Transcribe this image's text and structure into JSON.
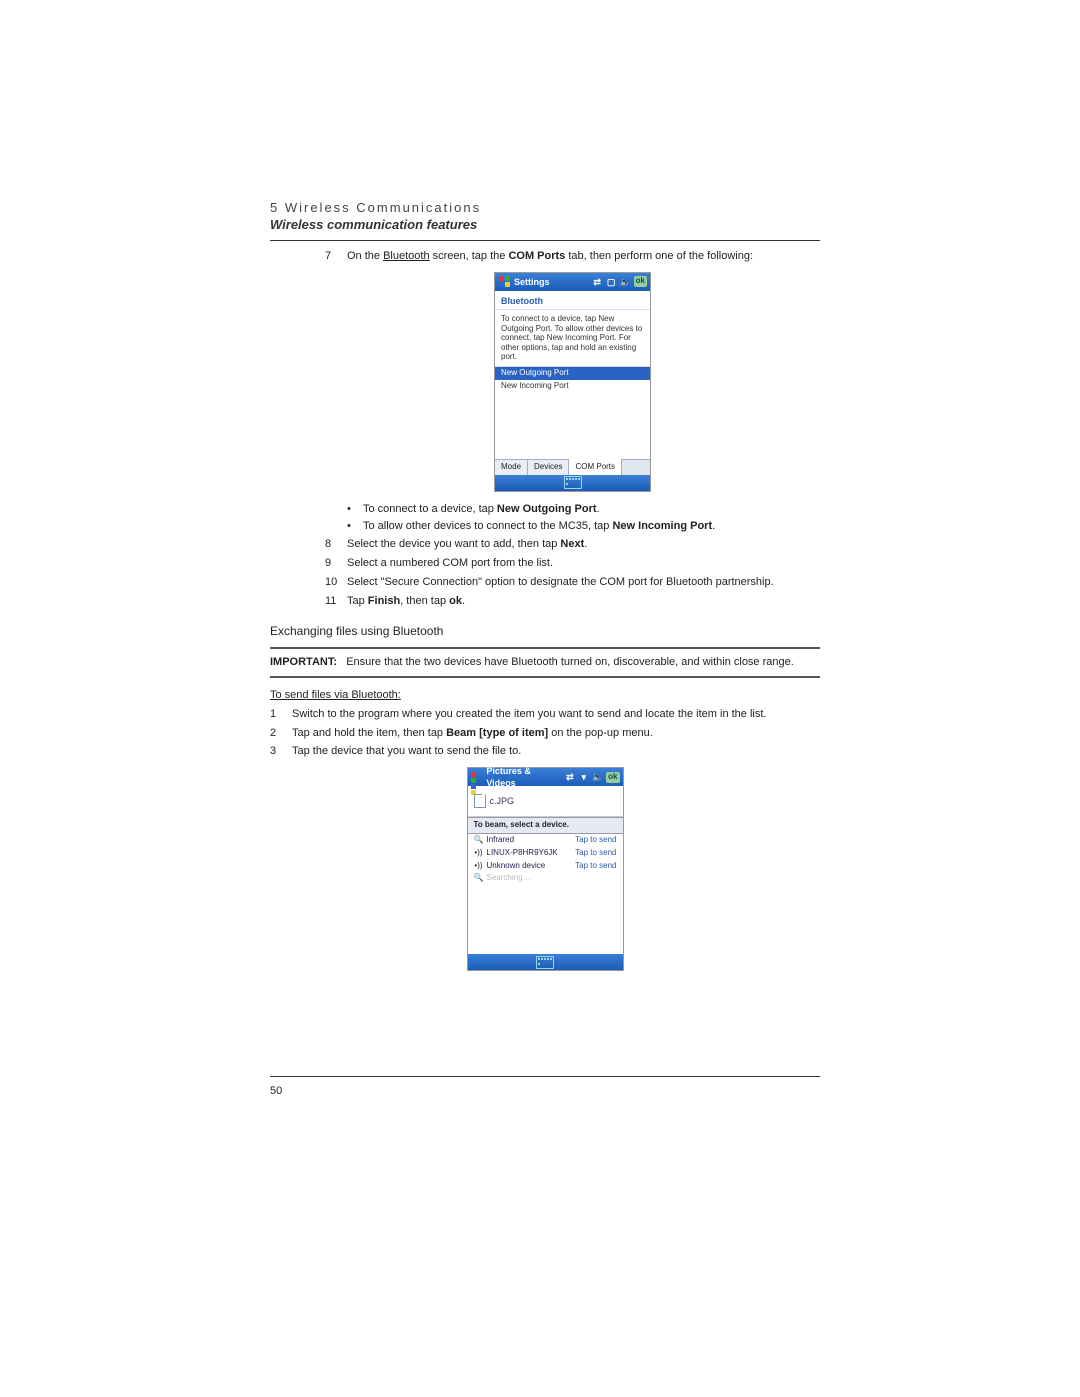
{
  "header": {
    "chapter": "5 Wireless Communications",
    "section": "Wireless communication features"
  },
  "steps_a": {
    "s7": {
      "num": "7",
      "text_pre": "On the ",
      "link": "Bluetooth",
      "text_mid": " screen, tap the ",
      "bold": "COM Ports",
      "text_post": " tab, then perform one of the following:"
    },
    "bullets": [
      {
        "pre": "To connect to a device, tap ",
        "bold": "New Outgoing Port",
        "post": "."
      },
      {
        "pre": "To allow other devices to connect to the MC35, tap ",
        "bold": "New Incoming Port",
        "post": "."
      }
    ],
    "s8": {
      "num": "8",
      "pre": "Select the device you want to add, then tap ",
      "bold": "Next",
      "post": "."
    },
    "s9": {
      "num": "9",
      "text": "Select a numbered COM port from the list."
    },
    "s10": {
      "num": "10",
      "text": "Select \"Secure Connection\" option to designate the COM port for Bluetooth partnership."
    },
    "s11": {
      "num": "11",
      "pre": "Tap ",
      "bold1": "Finish",
      "mid": ", then tap ",
      "bold2": "ok",
      "post": "."
    }
  },
  "subhead": "Exchanging files using Bluetooth",
  "important": {
    "label": "IMPORTANT:",
    "text": "Ensure that the two devices have Bluetooth turned on, discoverable, and within close range."
  },
  "send_head": "To send files via Bluetooth:",
  "steps_b": {
    "s1": {
      "num": "1",
      "text": "Switch to the program where you created the item you want to send and locate the item in the list."
    },
    "s2": {
      "num": "2",
      "pre": "Tap and hold the item, then tap ",
      "bold": "Beam [type of item]",
      "post": " on the pop-up menu."
    },
    "s3": {
      "num": "3",
      "text": "Tap the device that you want to send the file to."
    }
  },
  "device1": {
    "title": "Settings",
    "ok": "ok",
    "sub": "Bluetooth",
    "instr": "To connect to a device, tap New Outgoing Port. To allow other devices to connect, tap New Incoming Port. For other options, tap and hold an existing port.",
    "sel": "New Outgoing Port",
    "row": "New Incoming Port",
    "tabs": {
      "t1": "Mode",
      "t2": "Devices",
      "t3": "COM Ports"
    }
  },
  "device2": {
    "title": "Pictures & Videos",
    "ok": "ok",
    "file": "c.JPG",
    "beamhead": "To beam, select a device.",
    "rows": [
      {
        "icon": "🔍",
        "name": "Infrared",
        "action": "Tap to send"
      },
      {
        "icon": "•))",
        "name": "LINUX-P8HR9Y6JK",
        "action": "Tap to send"
      },
      {
        "icon": "•))",
        "name": "Unknown device",
        "action": "Tap to send"
      },
      {
        "icon": "🔍",
        "name": "Searching…",
        "action": ""
      }
    ]
  },
  "page_num": "50"
}
